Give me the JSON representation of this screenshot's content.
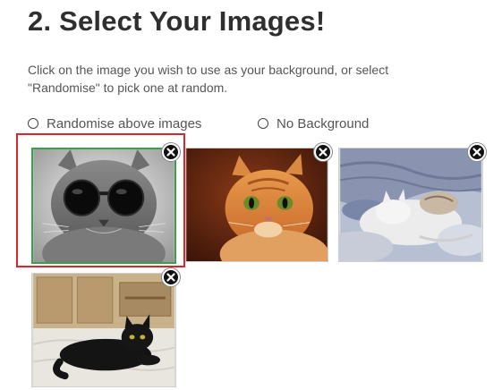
{
  "heading": "2. Select Your Images!",
  "description": {
    "line1": "Click on the image you wish to use as your background, or select",
    "line2": "\"Randomise\" to pick one at random."
  },
  "options": {
    "randomise_label": "Randomise above images",
    "no_background_label": "No Background"
  },
  "images": [
    {
      "name": "cat-with-sunglasses",
      "selected": true
    },
    {
      "name": "orange-tabby-cat",
      "selected": false
    },
    {
      "name": "cats-sleeping-on-bed",
      "selected": false
    },
    {
      "name": "black-cat-lying-on-bed",
      "selected": false
    }
  ],
  "icons": {
    "remove": "close-icon",
    "radio": "radio-icon"
  },
  "colors": {
    "selection_outline": "#d9262b",
    "selected_border": "#3aa04a",
    "heading_text": "#2f2f2f",
    "body_text": "#555555"
  }
}
